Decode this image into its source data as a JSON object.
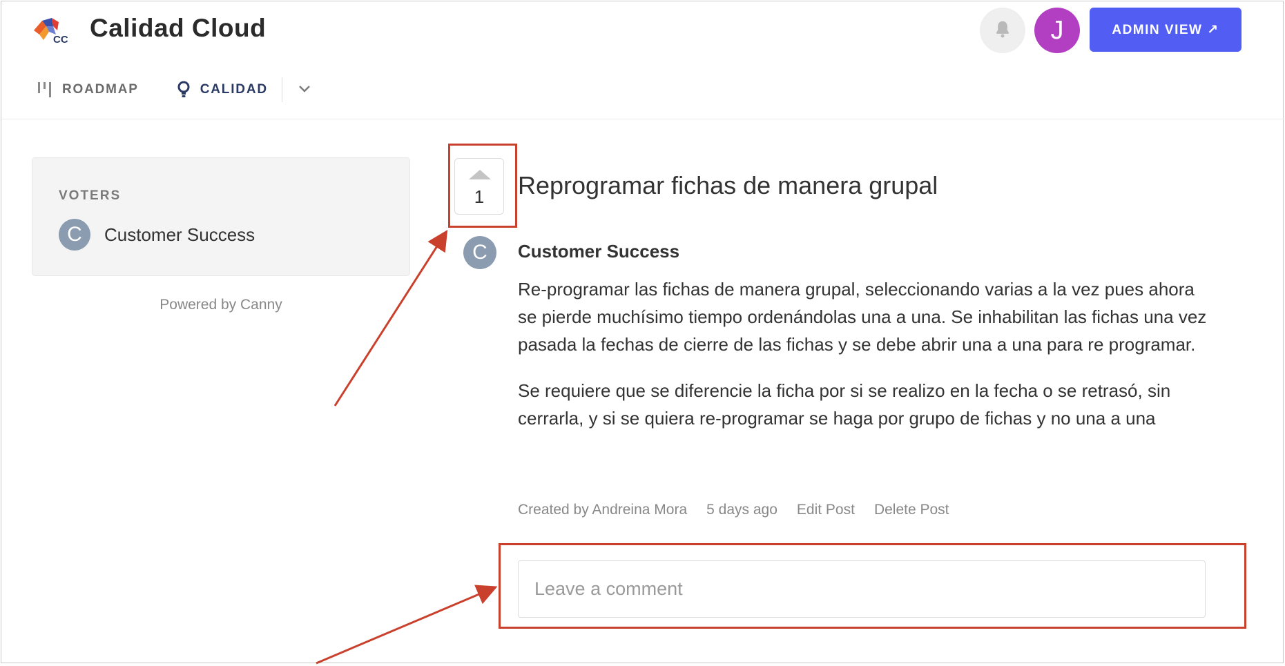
{
  "header": {
    "brand": "Calidad Cloud",
    "logo_text": "CC",
    "avatar_initial": "J",
    "admin_button": "ADMIN VIEW ↗"
  },
  "nav": {
    "roadmap": "ROADMAP",
    "calidad": "CALIDAD"
  },
  "sidebar": {
    "voters_title": "VOTERS",
    "voters": [
      {
        "initial": "C",
        "name": "Customer Success"
      }
    ],
    "powered_by": "Powered by Canny"
  },
  "post": {
    "vote_count": "1",
    "title": "Reprogramar fichas de manera grupal",
    "author_initial": "C",
    "author": "Customer Success",
    "paragraphs": [
      "Re-programar las fichas de manera grupal, seleccionando varias a la vez pues ahora se pierde muchísimo tiempo ordenándolas una a una. Se inhabilitan las fichas una vez pasada la fechas de cierre de las fichas y se debe abrir una a una para re programar.",
      "Se requiere que se diferencie la ficha por si se realizo en la fecha o se retrasó, sin cerrarla, y si se quiera re-programar se haga por grupo de fichas y no una a una"
    ],
    "meta": {
      "created_by": "Created by Andreina Mora",
      "time_ago": "5 days ago",
      "edit": "Edit Post",
      "delete": "Delete Post"
    },
    "comment_placeholder": "Leave a comment"
  },
  "colors": {
    "accent": "#525df4",
    "avatar_j": "#b23fc2",
    "avatar_c": "#8c9cb0",
    "annotation": "#c9412c"
  }
}
